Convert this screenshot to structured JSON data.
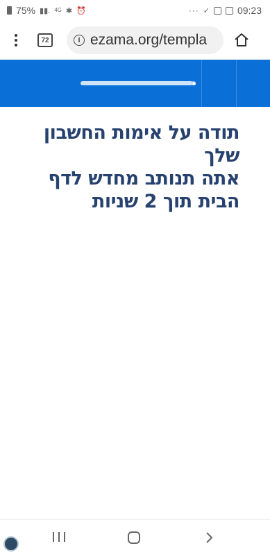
{
  "status_bar": {
    "battery": "75%",
    "network": "4G",
    "time": "09:23"
  },
  "browser": {
    "tab_count": "72",
    "url": "ezama.org/templa"
  },
  "progress": {
    "value_percent": 97
  },
  "message": {
    "line1": "תודה על אימות החשבון",
    "line2": "שלך",
    "line3": "אתה תנותב מחדש לדף",
    "line4": "הבית תוך 2 שניות"
  },
  "colors": {
    "header_blue": "#0a6fd6",
    "text_navy": "#27426f"
  }
}
